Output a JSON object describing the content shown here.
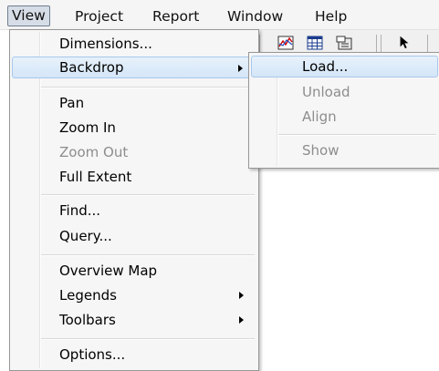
{
  "menubar": {
    "items": [
      {
        "label": "View"
      },
      {
        "label": "Project"
      },
      {
        "label": "Report"
      },
      {
        "label": "Window"
      },
      {
        "label": "Help"
      }
    ]
  },
  "view_menu": {
    "items": [
      {
        "label": "Dimensions..."
      },
      {
        "label": "Backdrop"
      },
      {
        "label": "Pan"
      },
      {
        "label": "Zoom In"
      },
      {
        "label": "Zoom Out"
      },
      {
        "label": "Full Extent"
      },
      {
        "label": "Find..."
      },
      {
        "label": "Query..."
      },
      {
        "label": "Overview Map"
      },
      {
        "label": "Legends"
      },
      {
        "label": "Toolbars"
      },
      {
        "label": "Options..."
      }
    ]
  },
  "backdrop_submenu": {
    "items": [
      {
        "label": "Load..."
      },
      {
        "label": "Unload"
      },
      {
        "label": "Align"
      },
      {
        "label": "Show"
      }
    ]
  },
  "toolbar": {
    "icons": [
      "graph-icon",
      "table-icon",
      "properties-icon",
      "select-pointer-icon"
    ]
  },
  "colors": {
    "highlight": "#d4e6f8",
    "disabled_text": "#8d8d8d",
    "menu_bg": "#f6f6f6"
  }
}
